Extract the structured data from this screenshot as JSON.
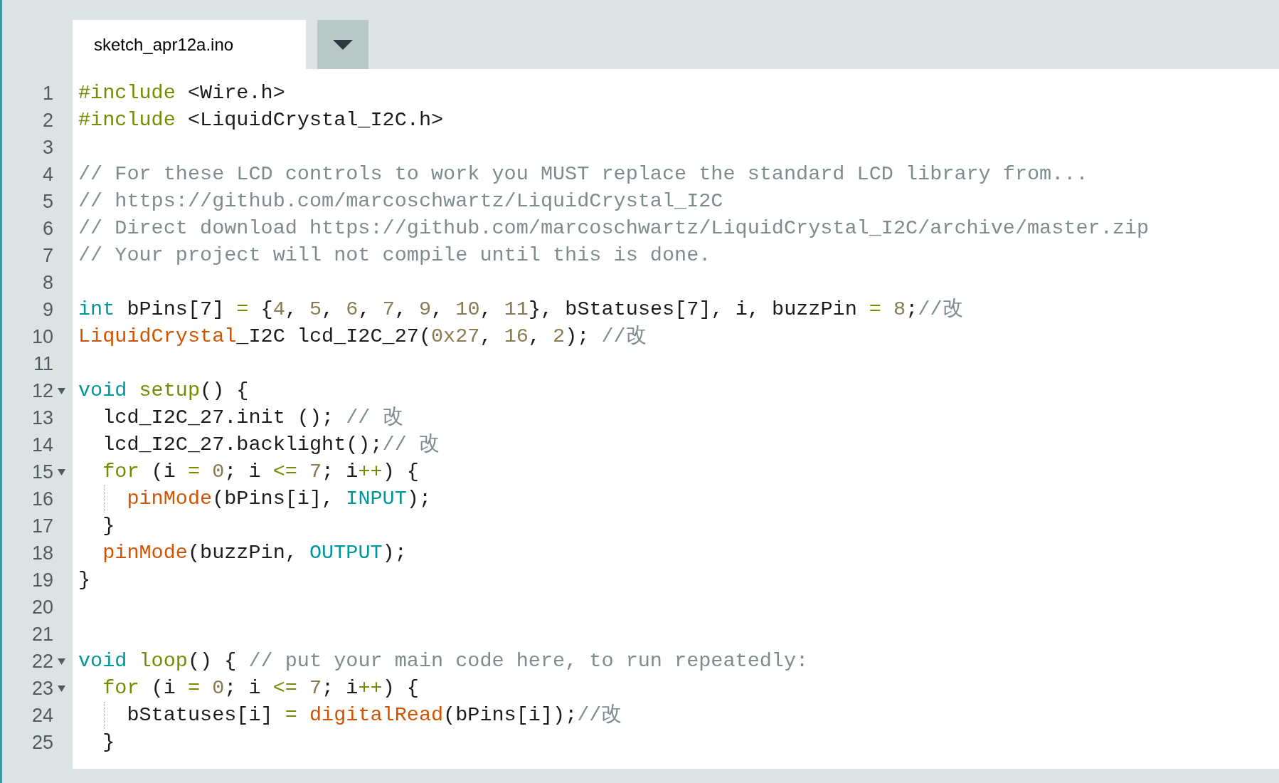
{
  "tabs": [
    {
      "label": "sketch_apr12a.ino",
      "selected": true
    }
  ],
  "lines": [
    {
      "number": "1",
      "fold": false,
      "guide": false,
      "tokens": [
        {
          "t": "#include",
          "kind": "directive"
        },
        {
          "t": " <Wire.h>",
          "kind": "plain"
        }
      ]
    },
    {
      "number": "2",
      "fold": false,
      "guide": false,
      "tokens": [
        {
          "t": "#include",
          "kind": "directive"
        },
        {
          "t": " <LiquidCrystal_I2C.h>",
          "kind": "plain"
        }
      ]
    },
    {
      "number": "3",
      "fold": false,
      "guide": false
    },
    {
      "number": "4",
      "fold": false,
      "guide": false,
      "tokens": [
        {
          "t": "// For these LCD controls to work you MUST replace the standard LCD library from...",
          "kind": "comment"
        }
      ]
    },
    {
      "number": "5",
      "fold": false,
      "guide": false,
      "tokens": [
        {
          "t": "// https://github.com/marcoschwartz/LiquidCrystal_I2C",
          "kind": "comment"
        }
      ]
    },
    {
      "number": "6",
      "fold": false,
      "guide": false,
      "tokens": [
        {
          "t": "// Direct download https://github.com/marcoschwartz/LiquidCrystal_I2C/archive/master.zip",
          "kind": "comment"
        }
      ]
    },
    {
      "number": "7",
      "fold": false,
      "guide": false,
      "tokens": [
        {
          "t": "// Your project will not compile until this is done.",
          "kind": "comment"
        }
      ]
    },
    {
      "number": "8",
      "fold": false,
      "guide": false
    },
    {
      "number": "9",
      "fold": false,
      "guide": false,
      "tokens": [
        {
          "t": "int",
          "kind": "type"
        },
        {
          "t": " bPins[7] ",
          "kind": "plain"
        },
        {
          "t": "=",
          "kind": "operator"
        },
        {
          "t": " {",
          "kind": "plain"
        },
        {
          "t": "4",
          "kind": "number"
        },
        {
          "t": ", ",
          "kind": "plain"
        },
        {
          "t": "5",
          "kind": "number"
        },
        {
          "t": ", ",
          "kind": "plain"
        },
        {
          "t": "6",
          "kind": "number"
        },
        {
          "t": ", ",
          "kind": "plain"
        },
        {
          "t": "7",
          "kind": "number"
        },
        {
          "t": ", ",
          "kind": "plain"
        },
        {
          "t": "9",
          "kind": "number"
        },
        {
          "t": ", ",
          "kind": "plain"
        },
        {
          "t": "10",
          "kind": "number"
        },
        {
          "t": ", ",
          "kind": "plain"
        },
        {
          "t": "11",
          "kind": "number"
        },
        {
          "t": "}, bStatuses[7], i, buzzPin ",
          "kind": "plain"
        },
        {
          "t": "=",
          "kind": "operator"
        },
        {
          "t": " 8",
          "kind": "number"
        },
        {
          "t": ";",
          "kind": "plain"
        },
        {
          "t": "//改",
          "kind": "comment"
        }
      ]
    },
    {
      "number": "10",
      "fold": false,
      "guide": false,
      "tokens": [
        {
          "t": "LiquidCrystal",
          "kind": "builtin"
        },
        {
          "t": "_I2C lcd_I2C_27(",
          "kind": "plain"
        },
        {
          "t": "0x27",
          "kind": "number"
        },
        {
          "t": ", ",
          "kind": "plain"
        },
        {
          "t": "16",
          "kind": "number"
        },
        {
          "t": ", ",
          "kind": "plain"
        },
        {
          "t": "2",
          "kind": "number"
        },
        {
          "t": "); ",
          "kind": "plain"
        },
        {
          "t": "//改",
          "kind": "comment"
        }
      ]
    },
    {
      "number": "11",
      "fold": false,
      "guide": false
    },
    {
      "number": "12",
      "fold": true,
      "guide": false,
      "tokens": [
        {
          "t": "void ",
          "kind": "type"
        },
        {
          "t": "setup",
          "kind": "function"
        },
        {
          "t": "() {",
          "kind": "plain"
        }
      ]
    },
    {
      "number": "13",
      "fold": false,
      "guide": false,
      "tokens": [
        {
          "t": "  lcd_I2C_27.init (); ",
          "kind": "plain"
        },
        {
          "t": "// 改",
          "kind": "comment"
        }
      ]
    },
    {
      "number": "14",
      "fold": false,
      "guide": false,
      "tokens": [
        {
          "t": "  lcd_I2C_27.backlight();",
          "kind": "plain"
        },
        {
          "t": "// 改",
          "kind": "comment"
        }
      ]
    },
    {
      "number": "15",
      "fold": true,
      "guide": false,
      "tokens": [
        {
          "t": "  for",
          "kind": "function"
        },
        {
          "t": " (i ",
          "kind": "plain"
        },
        {
          "t": "= ",
          "kind": "operator"
        },
        {
          "t": "0",
          "kind": "number"
        },
        {
          "t": "; i ",
          "kind": "plain"
        },
        {
          "t": "<= ",
          "kind": "operator"
        },
        {
          "t": "7",
          "kind": "number"
        },
        {
          "t": "; i",
          "kind": "plain"
        },
        {
          "t": "++",
          "kind": "operator"
        },
        {
          "t": ") {",
          "kind": "plain"
        }
      ]
    },
    {
      "number": "16",
      "fold": false,
      "guide": true,
      "tokens": [
        {
          "t": "    pinMode",
          "kind": "builtin"
        },
        {
          "t": "(bPins[i], ",
          "kind": "plain"
        },
        {
          "t": "INPUT",
          "kind": "type"
        },
        {
          "t": ");",
          "kind": "plain"
        }
      ]
    },
    {
      "number": "17",
      "fold": false,
      "guide": false,
      "tokens": [
        {
          "t": "  }",
          "kind": "plain"
        }
      ]
    },
    {
      "number": "18",
      "fold": false,
      "guide": false,
      "tokens": [
        {
          "t": "  pinMode",
          "kind": "builtin"
        },
        {
          "t": "(buzzPin, ",
          "kind": "plain"
        },
        {
          "t": "OUTPUT",
          "kind": "type"
        },
        {
          "t": ");",
          "kind": "plain"
        }
      ]
    },
    {
      "number": "19",
      "fold": false,
      "guide": false,
      "tokens": [
        {
          "t": "}",
          "kind": "plain"
        }
      ]
    },
    {
      "number": "20",
      "fold": false,
      "guide": false
    },
    {
      "number": "21",
      "fold": false,
      "guide": false
    },
    {
      "number": "22",
      "fold": true,
      "guide": false,
      "tokens": [
        {
          "t": "void ",
          "kind": "type"
        },
        {
          "t": "loop",
          "kind": "function"
        },
        {
          "t": "() { ",
          "kind": "plain"
        },
        {
          "t": "// put your main code here, to run repeatedly:",
          "kind": "comment"
        }
      ]
    },
    {
      "number": "23",
      "fold": true,
      "guide": false,
      "tokens": [
        {
          "t": "  for",
          "kind": "function"
        },
        {
          "t": " (i ",
          "kind": "plain"
        },
        {
          "t": "= ",
          "kind": "operator"
        },
        {
          "t": "0",
          "kind": "number"
        },
        {
          "t": "; i ",
          "kind": "plain"
        },
        {
          "t": "<= ",
          "kind": "operator"
        },
        {
          "t": "7",
          "kind": "number"
        },
        {
          "t": "; i",
          "kind": "plain"
        },
        {
          "t": "++",
          "kind": "operator"
        },
        {
          "t": ") {",
          "kind": "plain"
        }
      ]
    },
    {
      "number": "24",
      "fold": false,
      "guide": true,
      "tokens": [
        {
          "t": "    bStatuses[i] ",
          "kind": "plain"
        },
        {
          "t": "= ",
          "kind": "operator"
        },
        {
          "t": "digitalRead",
          "kind": "builtin"
        },
        {
          "t": "(bPins[i]);",
          "kind": "plain"
        },
        {
          "t": "//改",
          "kind": "comment"
        }
      ]
    },
    {
      "number": "25",
      "fold": false,
      "guide": false,
      "tokens": [
        {
          "t": "  }",
          "kind": "plain"
        }
      ]
    }
  ]
}
